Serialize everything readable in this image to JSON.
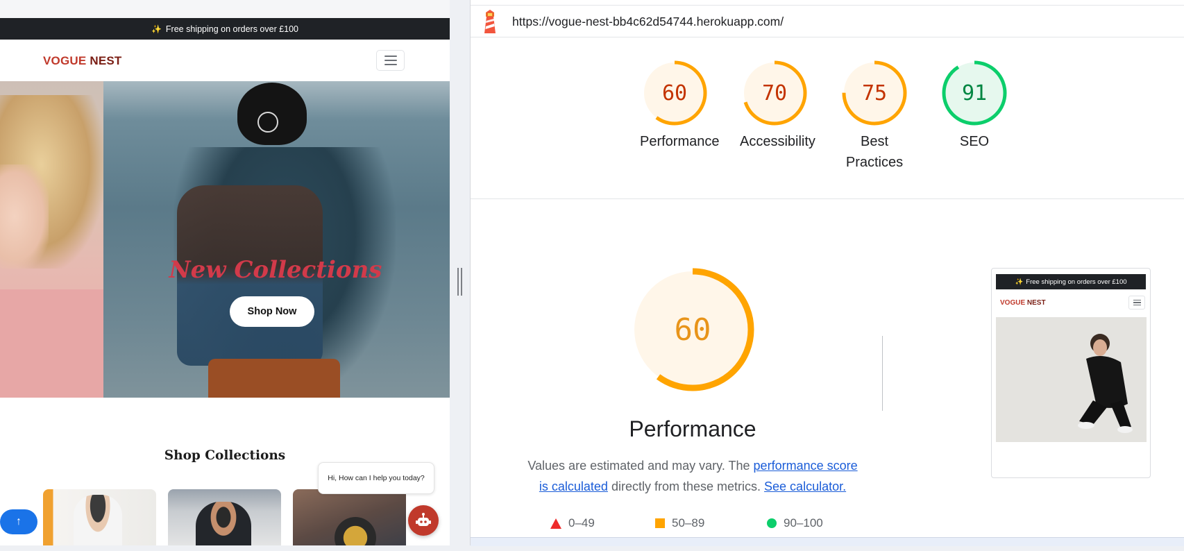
{
  "site": {
    "announcement": "Free shipping on orders over £100",
    "announcement_icon": "sparkle-icon",
    "logo_vogue": "VOGUE",
    "logo_nest": "NEST",
    "brand_color": "#c0392b",
    "hero_title": "New Collections",
    "hero_button": "Shop Now",
    "section_title": "Shop Collections",
    "chat_greeting": "Hi, How can I help you today?"
  },
  "lighthouse": {
    "url": "https://vogue-nest-bb4c62d54744.herokuapp.com/",
    "scores": [
      {
        "label": "Performance",
        "value": 60,
        "status": "average"
      },
      {
        "label": "Accessibility",
        "value": 70,
        "status": "average"
      },
      {
        "label": "Best Practices",
        "value": 75,
        "status": "average"
      },
      {
        "label": "SEO",
        "value": 91,
        "status": "pass"
      }
    ],
    "colors": {
      "fail": "#ee2b2b",
      "average": "#ffa400",
      "pass": "#0cce6b"
    },
    "main": {
      "score": "60",
      "title": "Performance",
      "desc_prefix": "Values are estimated and may vary. The",
      "desc_link1": "performance score is calculated",
      "desc_middle": "directly from these metrics.",
      "desc_link2": "See calculator."
    },
    "legend": [
      "0–49",
      "50–89",
      "90–100"
    ],
    "screenshot": {
      "announcement": "Free shipping on orders over £100",
      "logo_vogue": "VOGUE",
      "logo_nest": "NEST"
    }
  }
}
